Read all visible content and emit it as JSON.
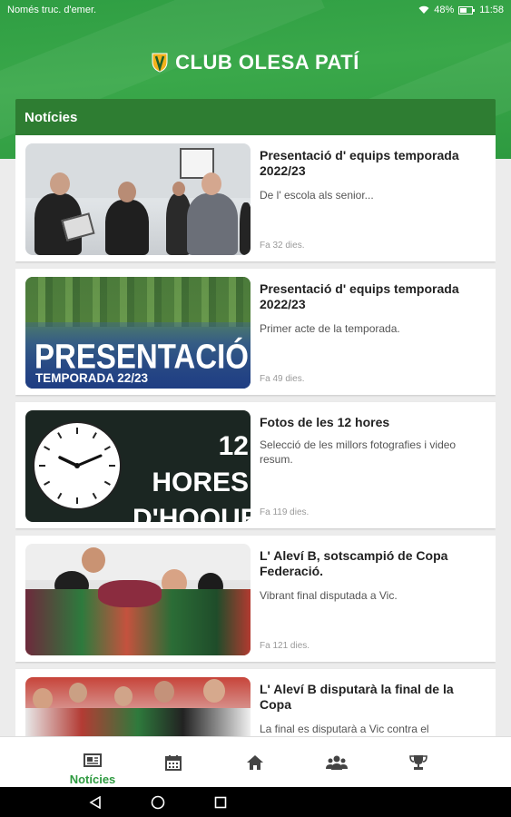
{
  "status_bar": {
    "left_text": "Només truc. d'emer.",
    "battery": "48%",
    "time": "11:58"
  },
  "header": {
    "title": "CLUB OLESA PATÍ"
  },
  "section": {
    "title": "Notícies"
  },
  "news": [
    {
      "title": "Presentació d' equips temporada 2022/23",
      "subtitle": "De l' escola als senior...",
      "time": "Fa 32 dies."
    },
    {
      "title": "Presentació d' equips temporada 2022/23",
      "subtitle": "Primer acte de la temporada.",
      "time": "Fa 49 dies.",
      "image_text": "PRESENTACIÓ",
      "image_subtext": "TEMPORADA 22/23"
    },
    {
      "title": "Fotos de les 12 hores",
      "subtitle": "Selecció de les millors fotografies i video resum.",
      "time": "Fa 119 dies.",
      "image_text_1": "12 HORES",
      "image_text_2": "D'HOQUEI"
    },
    {
      "title": "L' Aleví B, sotscampió de Copa Federació.",
      "subtitle": "Vibrant final disputada a Vic.",
      "time": "Fa 121 dies."
    },
    {
      "title": "L' Aleví B disputarà la final de la Copa",
      "subtitle": "La final es disputarà a Vic contra el",
      "time": ""
    }
  ],
  "bottom_nav": {
    "active_label": "Notícies",
    "items": [
      "news-icon",
      "calendar-icon",
      "home-icon",
      "team-icon",
      "trophy-icon"
    ]
  },
  "colors": {
    "brand_green": "#2e9a40",
    "section_green": "#2e7d32"
  }
}
